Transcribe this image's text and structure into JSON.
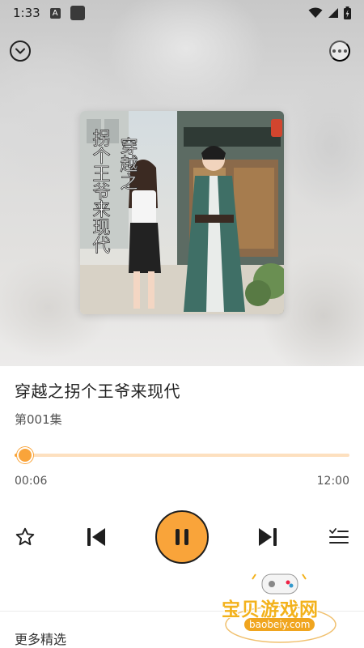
{
  "status_bar": {
    "time": "1:33",
    "a_badge": "A"
  },
  "icons": {
    "collapse": "chevron-down-icon",
    "more": "more-icon",
    "favorite": "star-icon",
    "previous": "skip-previous-icon",
    "play_pause": "pause-icon",
    "next": "skip-next-icon",
    "playlist": "playlist-icon"
  },
  "cover": {
    "title_line1": "穿越之",
    "title_line2": "拐个王爷来现代"
  },
  "track": {
    "title": "穿越之拐个王爷来现代",
    "episode": "第001集"
  },
  "progress": {
    "current": "00:06",
    "total": "12:00",
    "fraction": 0.008
  },
  "section": {
    "more_picks": "更多精选"
  },
  "watermark": {
    "text": "宝贝游戏网",
    "url": "baobeiy.com"
  },
  "colors": {
    "accent": "#f9a43a",
    "track_bg": "#fde0bf"
  }
}
